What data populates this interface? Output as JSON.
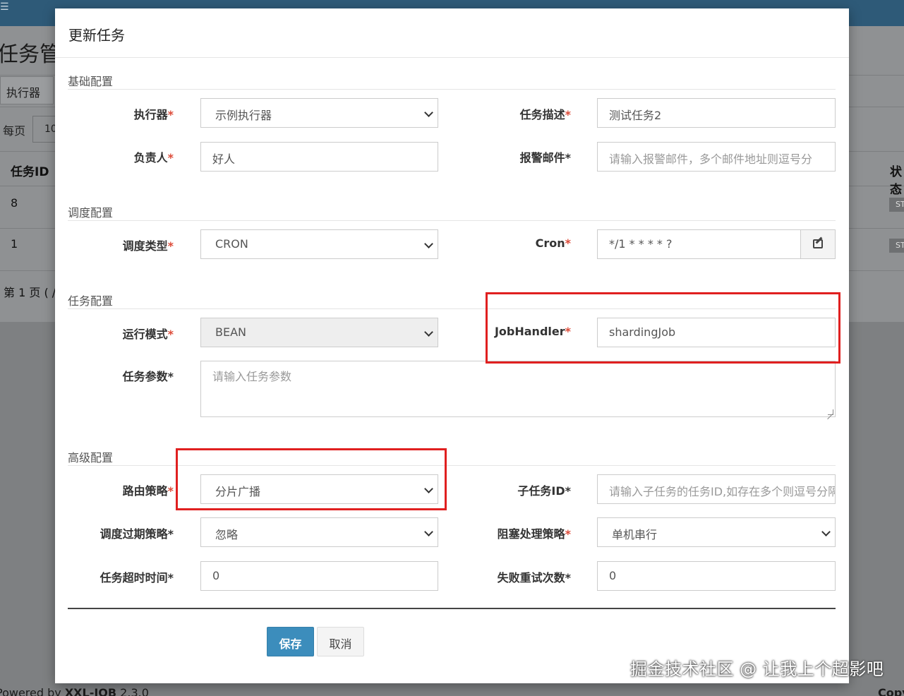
{
  "background": {
    "page_title": "任务管",
    "executor_button": "执行器",
    "per_page_label": "每页",
    "per_page_value": "10",
    "table_header_id": "任务ID",
    "table_header_status": "状态",
    "rows": [
      {
        "id": "8",
        "status": "ST"
      },
      {
        "id": "1",
        "status": "ST"
      }
    ],
    "page_info": "第 1 页 ( /",
    "footer_powered_prefix": "Powered by ",
    "footer_powered_name": "XXL-JOB",
    "footer_version": " 2.3.0",
    "footer_copyright": "Copy"
  },
  "modal": {
    "title": "更新任务",
    "sections": {
      "basic": "基础配置",
      "schedule": "调度配置",
      "task": "任务配置",
      "advanced": "高级配置"
    },
    "fields": {
      "executor": {
        "label": "执行器",
        "value": "示例执行器"
      },
      "job_desc": {
        "label": "任务描述",
        "value": "测试任务2"
      },
      "author": {
        "label": "负责人",
        "value": "好人"
      },
      "alarm_email": {
        "label": "报警邮件*",
        "placeholder": "请输入报警邮件，多个邮件地址则逗号分"
      },
      "schedule_type": {
        "label": "调度类型",
        "value": "CRON"
      },
      "cron": {
        "label": "Cron",
        "value": "*/1 * * * * ?"
      },
      "glue_type": {
        "label": "运行模式",
        "value": "BEAN"
      },
      "job_handler": {
        "label": "JobHandler",
        "value": "shardingJob"
      },
      "job_param": {
        "label": "任务参数*",
        "placeholder": "请输入任务参数"
      },
      "route_strategy": {
        "label": "路由策略",
        "value": "分片广播"
      },
      "child_job_id": {
        "label": "子任务ID*",
        "placeholder": "请输入子任务的任务ID,如存在多个则逗号分隔"
      },
      "misfire_strategy": {
        "label": "调度过期策略*",
        "value": "忽略"
      },
      "block_strategy": {
        "label": "阻塞处理策略",
        "value": "单机串行"
      },
      "timeout": {
        "label": "任务超时时间*",
        "value": "0"
      },
      "fail_retry": {
        "label": "失败重试次数*",
        "value": "0"
      }
    },
    "required_mark": "*",
    "buttons": {
      "save": "保存",
      "cancel": "取消"
    }
  },
  "watermark": "掘金技术社区 @ 让我上个超影吧",
  "colors": {
    "primary": "#3c8dbc",
    "required": "#dd4b39",
    "highlight_box": "#e02020",
    "topbar": "#2e5a78"
  }
}
